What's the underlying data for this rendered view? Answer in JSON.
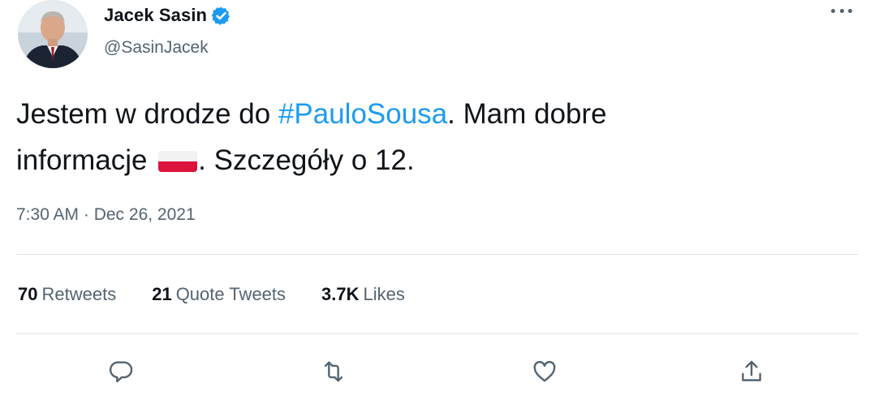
{
  "author": {
    "display_name": "Jacek Sasin",
    "handle": "@SasinJacek",
    "verified": true
  },
  "tweet": {
    "text_part1": "Jestem w drodze do ",
    "hashtag": "#PauloSousa",
    "text_part2": ". Mam dobre",
    "text_part3": "informacje ",
    "flag_icon": "poland-flag-icon",
    "text_part4": ". Szczegóły o 12."
  },
  "meta": {
    "timestamp": "7:30 AM · Dec 26, 2021"
  },
  "stats": {
    "retweets_count": "70",
    "retweets_label": "Retweets",
    "quotes_count": "21",
    "quotes_label": "Quote Tweets",
    "likes_count": "3.7K",
    "likes_label": "Likes"
  },
  "icons": {
    "reply": "reply-icon",
    "retweet": "retweet-icon",
    "like": "heart-icon",
    "share": "share-icon",
    "more": "more-icon",
    "verified": "verified-badge-icon"
  },
  "colors": {
    "accent": "#1d9bf0",
    "text": "#0f1419",
    "secondary": "#536471"
  }
}
